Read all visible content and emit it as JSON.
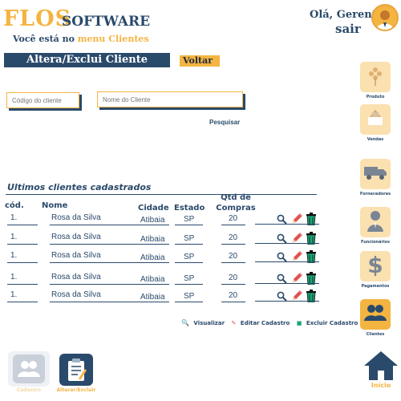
{
  "brand": {
    "flos": "FLOS",
    "software": "SOFTWARE"
  },
  "location": {
    "prefix": "Você está no ",
    "menu": "menu Clientes"
  },
  "user": {
    "greeting": "Olá, Gerente",
    "logout": "sair"
  },
  "page_title": "Altera/Exclui Cliente",
  "back_button": "Voltar",
  "search": {
    "code_placeholder": "Código do cliente",
    "name_placeholder": "Nome do Cliente",
    "submit": "Pesquisar"
  },
  "section_title": "Ultimos clientes cadastrados",
  "table": {
    "headers": {
      "cod": "cód.",
      "nome": "Nome",
      "cidade": "Cidade",
      "estado": "Estado",
      "qtd": "Qtd de Compras"
    },
    "rows": [
      {
        "cod": "1.",
        "nome": "Rosa da Silva",
        "cidade": "Atibaia",
        "estado": "SP",
        "qtd": "20"
      },
      {
        "cod": "1.",
        "nome": "Rosa da Silva",
        "cidade": "Atibaia",
        "estado": "SP",
        "qtd": "20"
      },
      {
        "cod": "1.",
        "nome": "Rosa da Silva",
        "cidade": "Atibaia",
        "estado": "SP",
        "qtd": "20"
      },
      {
        "cod": "1.",
        "nome": "Rosa da Silva",
        "cidade": "Atibaia",
        "estado": "SP",
        "qtd": "20"
      },
      {
        "cod": "1.",
        "nome": "Rosa da Silva",
        "cidade": "Atibaia",
        "estado": "SP",
        "qtd": "20"
      }
    ]
  },
  "legend": {
    "view": "Visualizar",
    "edit": "Editar Cadastro",
    "delete": "Excluir Cadastro"
  },
  "sidebar": {
    "items": [
      {
        "label": "Produto",
        "icon": "flower-icon"
      },
      {
        "label": "Vendas",
        "icon": "cart-icon"
      },
      {
        "label": "Fornecedores",
        "icon": "truck-icon"
      },
      {
        "label": "Funcionários",
        "icon": "employee-icon"
      },
      {
        "label": "Pagamentos",
        "icon": "dollar-icon"
      },
      {
        "label": "Clientes",
        "icon": "users-icon"
      }
    ],
    "home_label": "Início"
  },
  "bottom_tabs": [
    {
      "label": "Cadastro",
      "icon": "users-icon"
    },
    {
      "label": "Alterar/Excluir",
      "icon": "clipboard-icon"
    }
  ],
  "colors": {
    "navy": "#2a4a6b",
    "orange": "#f4b441",
    "peach": "#fbe0b0",
    "trash_green": "#1aa57a",
    "pencil_red": "#e05050"
  }
}
